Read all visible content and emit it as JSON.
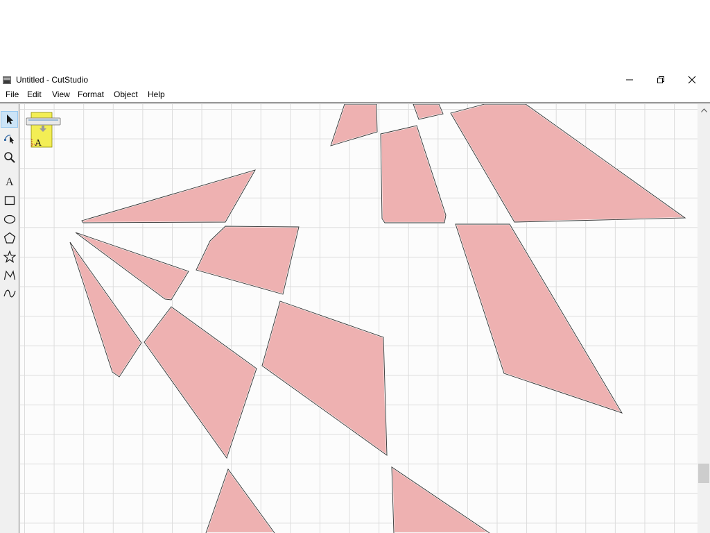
{
  "window": {
    "title": "Untitled - CutStudio",
    "minimize_icon": "minimize-icon",
    "maximize_icon": "restore-icon",
    "close_icon": "close-icon"
  },
  "menu": {
    "items": [
      {
        "label": "File"
      },
      {
        "label": "Edit"
      },
      {
        "label": "View"
      },
      {
        "label": "Format"
      },
      {
        "label": "Object"
      },
      {
        "label": "Help"
      }
    ]
  },
  "toolbox": {
    "tools": [
      {
        "name": "select-tool",
        "icon": "pointer-arrow-icon",
        "active": true
      },
      {
        "name": "node-edit-tool",
        "icon": "node-edit-icon",
        "active": false
      },
      {
        "name": "zoom-tool",
        "icon": "magnifier-icon",
        "active": false
      },
      {
        "name": "text-tool",
        "icon": "text-A-icon",
        "active": false
      },
      {
        "name": "rectangle-tool",
        "icon": "rectangle-icon",
        "active": false
      },
      {
        "name": "ellipse-tool",
        "icon": "ellipse-icon",
        "active": false
      },
      {
        "name": "polygon-tool",
        "icon": "pentagon-icon",
        "active": false
      },
      {
        "name": "star-tool",
        "icon": "star-icon",
        "active": false
      },
      {
        "name": "polyline-tool",
        "icon": "polyline-icon",
        "active": false
      },
      {
        "name": "curve-tool",
        "icon": "curve-icon",
        "active": false
      }
    ]
  },
  "canvas": {
    "background": "#fcfcfc",
    "grid_color": "#dcdcdc",
    "shape_fill": "#eeb1b1",
    "shape_count": 14,
    "cutter_icon": "cutter-media-icon",
    "cutter_label": "A"
  },
  "colors": {
    "selected_tool_bg": "#cce4f7",
    "toolbox_bg": "#f0f0f0"
  }
}
